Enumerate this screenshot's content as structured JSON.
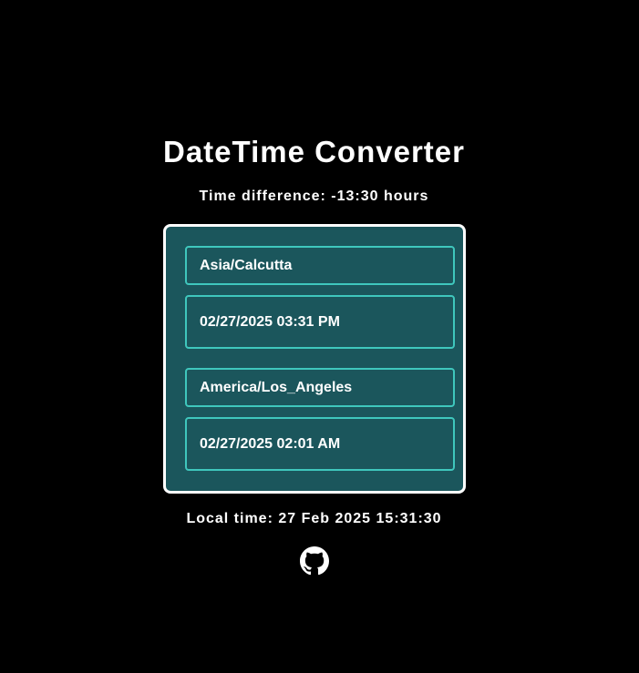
{
  "app": {
    "title": "DateTime Converter",
    "time_difference": "Time difference: -13:30 hours"
  },
  "source": {
    "timezone": "Asia/Calcutta",
    "datetime": "02/27/2025 03:31 PM"
  },
  "target": {
    "timezone": "America/Los_Angeles",
    "datetime": "02/27/2025 02:01 AM"
  },
  "footer": {
    "local_time": "Local time: 27 Feb 2025 15:31:30",
    "github_icon": "github-icon"
  },
  "colors": {
    "background": "#000000",
    "panel": "#1b565c",
    "field_border": "#3fc7bd",
    "panel_border": "#ffffff",
    "text": "#ffffff"
  }
}
